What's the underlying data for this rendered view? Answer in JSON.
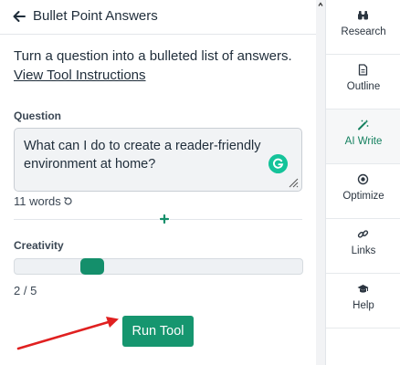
{
  "header": {
    "title": "Bullet Point Answers"
  },
  "intro": {
    "text": "Turn a question into a bulleted list of answers.",
    "link": "View Tool Instructions"
  },
  "question": {
    "label": "Question",
    "value": "What can I do to create a reader-friendly environment at home?",
    "word_count": "11 words"
  },
  "creativity": {
    "label": "Creativity",
    "value_text": "2 / 5",
    "value": 2,
    "max": 5
  },
  "run_button": {
    "label": "Run Tool"
  },
  "sidebar": {
    "items": [
      {
        "label": "Research",
        "icon": "binoculars-icon"
      },
      {
        "label": "Outline",
        "icon": "document-icon"
      },
      {
        "label": "AI Write",
        "icon": "magic-wand-icon",
        "active": true
      },
      {
        "label": "Optimize",
        "icon": "target-icon"
      },
      {
        "label": "Links",
        "icon": "link-icon"
      },
      {
        "label": "Help",
        "icon": "graduation-cap-icon"
      }
    ]
  },
  "colors": {
    "accent": "#16966f",
    "active_text": "#14805f",
    "arrow": "#e02020",
    "grammarly": "#15c39a"
  }
}
